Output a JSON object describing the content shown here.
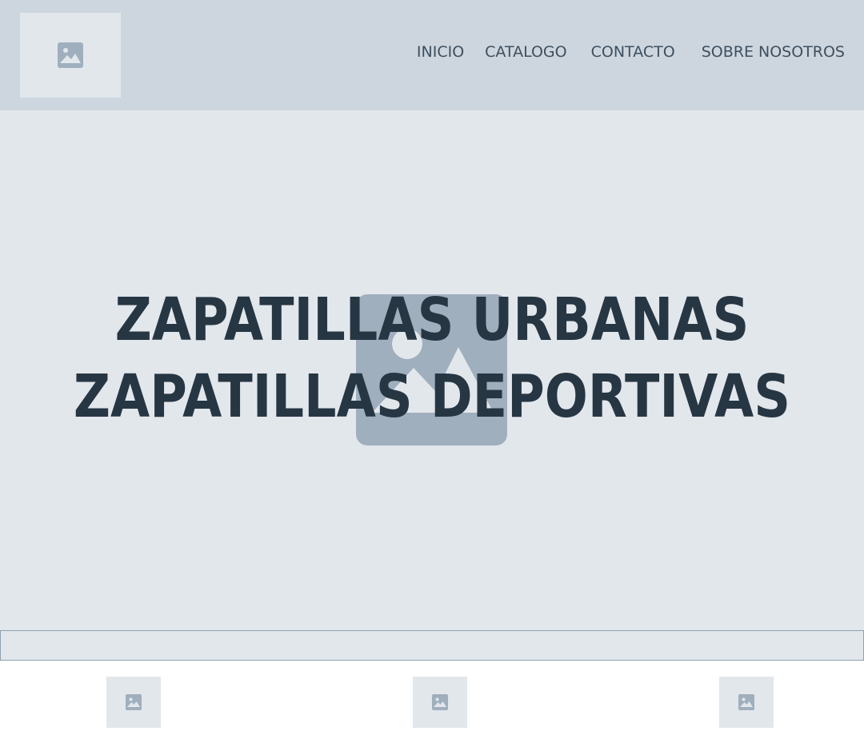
{
  "nav": {
    "items": [
      {
        "label": "INICIO"
      },
      {
        "label": "CATALOGO"
      },
      {
        "label": "CONTACTO"
      },
      {
        "label": "SOBRE NOSOTROS"
      }
    ]
  },
  "hero": {
    "title_line1": "ZAPATILLAS URBANAS",
    "title_line2": "ZAPATILLAS DEPORTIVAS"
  },
  "icons": {
    "logo": "image-placeholder-icon",
    "hero": "image-placeholder-icon",
    "thumbnails": [
      "image-placeholder-icon",
      "image-placeholder-icon",
      "image-placeholder-icon"
    ]
  },
  "colors": {
    "header_bg": "#cdd6df",
    "placeholder_bg": "#e2e7ec",
    "placeholder_icon": "#9fafbd",
    "text_dark": "#273643"
  }
}
